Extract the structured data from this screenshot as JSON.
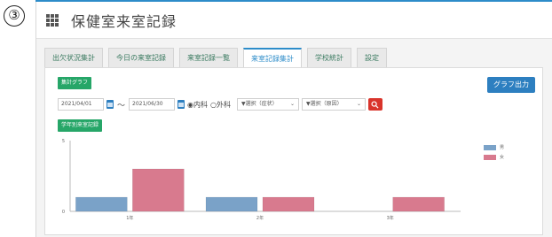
{
  "step_marker": "③",
  "header": {
    "title": "保健室来室記録"
  },
  "tabs": [
    {
      "label": "出欠状況集計",
      "active": false
    },
    {
      "label": "今日の来室記録",
      "active": false
    },
    {
      "label": "来室記録一覧",
      "active": false
    },
    {
      "label": "来室記録集計",
      "active": true
    },
    {
      "label": "学校統計",
      "active": false
    },
    {
      "label": "設定",
      "active": false
    }
  ],
  "panel": {
    "graph_button": "集計グラフ",
    "export_button": "グラフ出力",
    "grade_button": "学年別来室記録",
    "filters": {
      "date_from": "2021/04/01",
      "date_to": "2021/06/30",
      "tilde": "〜",
      "radio_internal": "◉内科",
      "radio_surgery": "○外科",
      "select_symptom": "▼選択（症状）",
      "select_cause": "▼選択（原因）"
    }
  },
  "colors": {
    "male": "#7aa2c8",
    "female": "#d87a8e",
    "accent": "#2d8cc9"
  },
  "chart_data": {
    "type": "bar",
    "categories": [
      "1年",
      "2年",
      "3年"
    ],
    "series": [
      {
        "name": "男",
        "values": [
          1,
          1,
          0
        ]
      },
      {
        "name": "女",
        "values": [
          3,
          1,
          1
        ]
      }
    ],
    "ylim": [
      0,
      5
    ],
    "yticks": [
      "0",
      "5"
    ],
    "legend": "right"
  }
}
